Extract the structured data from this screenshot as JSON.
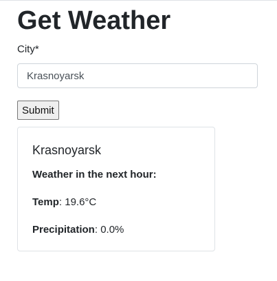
{
  "page": {
    "title": "Get Weather"
  },
  "form": {
    "city_label": "City*",
    "city_value": "Krasnoyarsk",
    "submit_label": "Submit"
  },
  "result": {
    "city": "Krasnoyarsk",
    "heading": "Weather in the next hour:",
    "temp_label": "Temp",
    "temp_value": ": 19.6°C",
    "precip_label": "Precipitation",
    "precip_value": ": 0.0%"
  }
}
